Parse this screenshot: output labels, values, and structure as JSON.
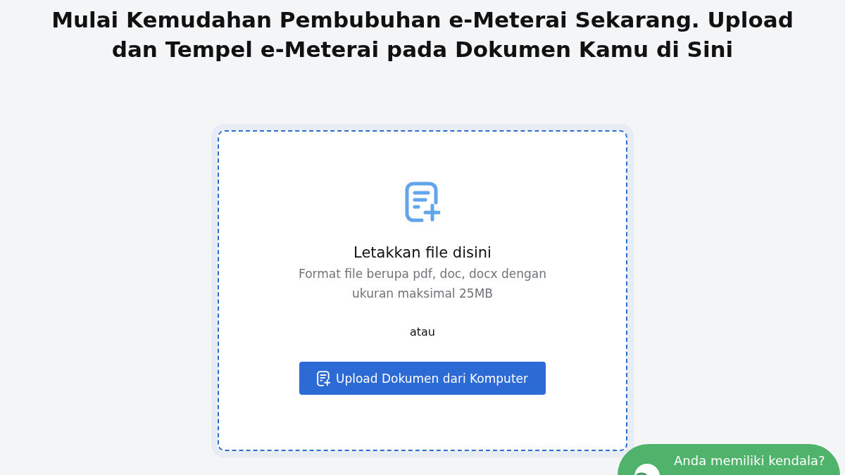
{
  "heading": "Mulai Kemudahan Pembubuhan e-Meterai Sekarang. Upload dan Tempel e-Meterai pada Dokumen Kamu di Sini",
  "upload_area": {
    "title": "Letakkan file disini",
    "description": "Format file berupa pdf, doc, docx dengan ukuran maksimal 25MB",
    "separator": "atau",
    "button": "Upload Dokumen dari Komputer"
  },
  "help_widget": {
    "label": "Anda memiliki kendala?"
  }
}
